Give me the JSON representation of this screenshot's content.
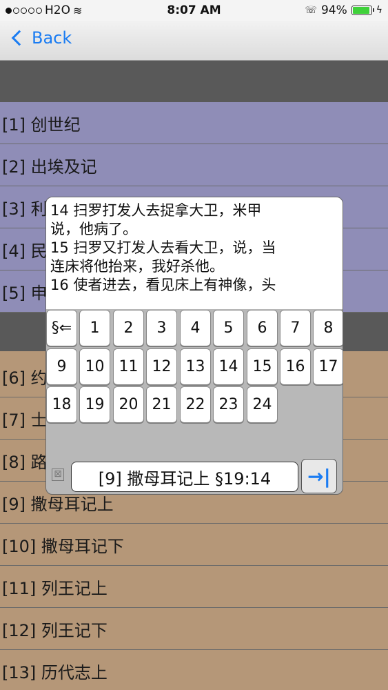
{
  "status": {
    "carrier": "H2O",
    "time": "8:07 AM",
    "battery": "94%",
    "battery_level": 0.94
  },
  "nav": {
    "back_label": "Back"
  },
  "books": [
    "[1] 创世纪",
    "[2] 出埃及记",
    "[3] 利",
    "[4] 民",
    "[5] 申",
    "[6] 约",
    "[7] 士",
    "[8] 路",
    "[9] 撒母耳记上",
    "[10] 撒母耳记下",
    "[11] 列王记上",
    "[12] 列王记下",
    "[13] 历代志上"
  ],
  "popup": {
    "verse_text": [
      "14 扫罗打发人去捉拿大卫，米甲",
      "说，他病了。",
      "15 扫罗又打发人去看大卫，说，当",
      "连床将他抬来，我好杀他。",
      "16 使者进去，看见床上有神像，头"
    ],
    "backspace_key": "§⇐",
    "keys": [
      "1",
      "2",
      "3",
      "4",
      "5",
      "6",
      "7",
      "8",
      "9",
      "10",
      "11",
      "12",
      "13",
      "14",
      "15",
      "16",
      "17",
      "18",
      "19",
      "20",
      "21",
      "22",
      "23",
      "24"
    ],
    "clear_icon": "⊠",
    "reference": "[9] 撒母耳记上 §19:14",
    "go_icon": "→|"
  }
}
